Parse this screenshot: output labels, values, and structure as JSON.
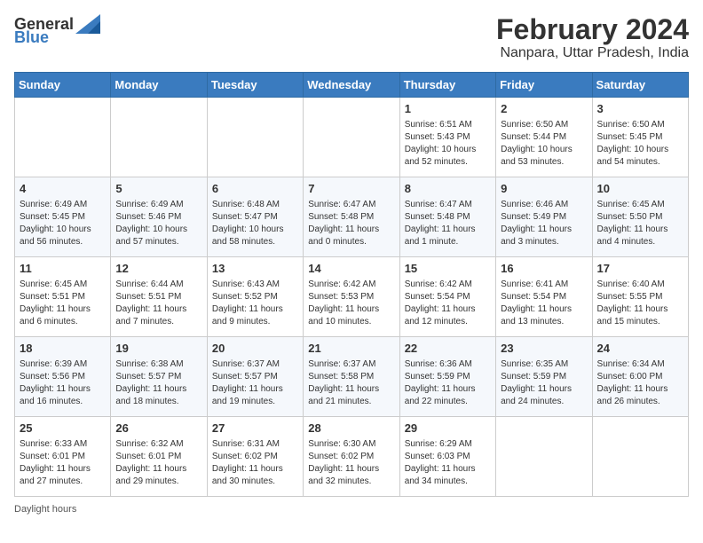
{
  "logo": {
    "general": "General",
    "blue": "Blue"
  },
  "title": "February 2024",
  "subtitle": "Nanpara, Uttar Pradesh, India",
  "days_of_week": [
    "Sunday",
    "Monday",
    "Tuesday",
    "Wednesday",
    "Thursday",
    "Friday",
    "Saturday"
  ],
  "weeks": [
    [
      {
        "day": "",
        "info": ""
      },
      {
        "day": "",
        "info": ""
      },
      {
        "day": "",
        "info": ""
      },
      {
        "day": "",
        "info": ""
      },
      {
        "day": "1",
        "info": "Sunrise: 6:51 AM\nSunset: 5:43 PM\nDaylight: 10 hours and 52 minutes."
      },
      {
        "day": "2",
        "info": "Sunrise: 6:50 AM\nSunset: 5:44 PM\nDaylight: 10 hours and 53 minutes."
      },
      {
        "day": "3",
        "info": "Sunrise: 6:50 AM\nSunset: 5:45 PM\nDaylight: 10 hours and 54 minutes."
      }
    ],
    [
      {
        "day": "4",
        "info": "Sunrise: 6:49 AM\nSunset: 5:45 PM\nDaylight: 10 hours and 56 minutes."
      },
      {
        "day": "5",
        "info": "Sunrise: 6:49 AM\nSunset: 5:46 PM\nDaylight: 10 hours and 57 minutes."
      },
      {
        "day": "6",
        "info": "Sunrise: 6:48 AM\nSunset: 5:47 PM\nDaylight: 10 hours and 58 minutes."
      },
      {
        "day": "7",
        "info": "Sunrise: 6:47 AM\nSunset: 5:48 PM\nDaylight: 11 hours and 0 minutes."
      },
      {
        "day": "8",
        "info": "Sunrise: 6:47 AM\nSunset: 5:48 PM\nDaylight: 11 hours and 1 minute."
      },
      {
        "day": "9",
        "info": "Sunrise: 6:46 AM\nSunset: 5:49 PM\nDaylight: 11 hours and 3 minutes."
      },
      {
        "day": "10",
        "info": "Sunrise: 6:45 AM\nSunset: 5:50 PM\nDaylight: 11 hours and 4 minutes."
      }
    ],
    [
      {
        "day": "11",
        "info": "Sunrise: 6:45 AM\nSunset: 5:51 PM\nDaylight: 11 hours and 6 minutes."
      },
      {
        "day": "12",
        "info": "Sunrise: 6:44 AM\nSunset: 5:51 PM\nDaylight: 11 hours and 7 minutes."
      },
      {
        "day": "13",
        "info": "Sunrise: 6:43 AM\nSunset: 5:52 PM\nDaylight: 11 hours and 9 minutes."
      },
      {
        "day": "14",
        "info": "Sunrise: 6:42 AM\nSunset: 5:53 PM\nDaylight: 11 hours and 10 minutes."
      },
      {
        "day": "15",
        "info": "Sunrise: 6:42 AM\nSunset: 5:54 PM\nDaylight: 11 hours and 12 minutes."
      },
      {
        "day": "16",
        "info": "Sunrise: 6:41 AM\nSunset: 5:54 PM\nDaylight: 11 hours and 13 minutes."
      },
      {
        "day": "17",
        "info": "Sunrise: 6:40 AM\nSunset: 5:55 PM\nDaylight: 11 hours and 15 minutes."
      }
    ],
    [
      {
        "day": "18",
        "info": "Sunrise: 6:39 AM\nSunset: 5:56 PM\nDaylight: 11 hours and 16 minutes."
      },
      {
        "day": "19",
        "info": "Sunrise: 6:38 AM\nSunset: 5:57 PM\nDaylight: 11 hours and 18 minutes."
      },
      {
        "day": "20",
        "info": "Sunrise: 6:37 AM\nSunset: 5:57 PM\nDaylight: 11 hours and 19 minutes."
      },
      {
        "day": "21",
        "info": "Sunrise: 6:37 AM\nSunset: 5:58 PM\nDaylight: 11 hours and 21 minutes."
      },
      {
        "day": "22",
        "info": "Sunrise: 6:36 AM\nSunset: 5:59 PM\nDaylight: 11 hours and 22 minutes."
      },
      {
        "day": "23",
        "info": "Sunrise: 6:35 AM\nSunset: 5:59 PM\nDaylight: 11 hours and 24 minutes."
      },
      {
        "day": "24",
        "info": "Sunrise: 6:34 AM\nSunset: 6:00 PM\nDaylight: 11 hours and 26 minutes."
      }
    ],
    [
      {
        "day": "25",
        "info": "Sunrise: 6:33 AM\nSunset: 6:01 PM\nDaylight: 11 hours and 27 minutes."
      },
      {
        "day": "26",
        "info": "Sunrise: 6:32 AM\nSunset: 6:01 PM\nDaylight: 11 hours and 29 minutes."
      },
      {
        "day": "27",
        "info": "Sunrise: 6:31 AM\nSunset: 6:02 PM\nDaylight: 11 hours and 30 minutes."
      },
      {
        "day": "28",
        "info": "Sunrise: 6:30 AM\nSunset: 6:02 PM\nDaylight: 11 hours and 32 minutes."
      },
      {
        "day": "29",
        "info": "Sunrise: 6:29 AM\nSunset: 6:03 PM\nDaylight: 11 hours and 34 minutes."
      },
      {
        "day": "",
        "info": ""
      },
      {
        "day": "",
        "info": ""
      }
    ]
  ],
  "footer": {
    "daylight_label": "Daylight hours"
  }
}
